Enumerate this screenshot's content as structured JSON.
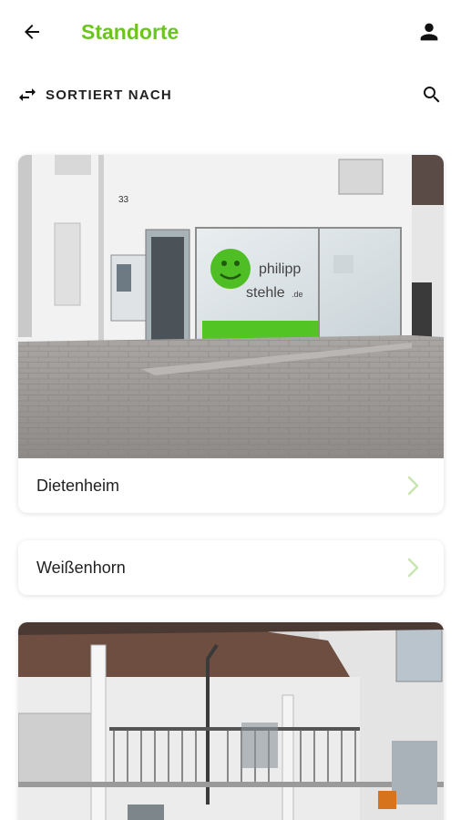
{
  "header": {
    "title": "Standorte"
  },
  "sortbar": {
    "sort_label": "SORTIERT NACH"
  },
  "locations": [
    {
      "name": "Dietenheim"
    },
    {
      "name": "Weißenhorn"
    }
  ],
  "storefront": {
    "house_number": "33",
    "logo_line1": "philipp",
    "logo_line2": "stehle",
    "logo_suffix": ".de"
  },
  "colors": {
    "accent": "#6cc51f",
    "text": "#222222",
    "chevron": "#c8e6b0"
  },
  "icons": {
    "back": "arrow-left-icon",
    "account": "person-icon",
    "sort": "swap-horiz-icon",
    "search": "search-icon",
    "chevron": "chevron-right-icon"
  }
}
